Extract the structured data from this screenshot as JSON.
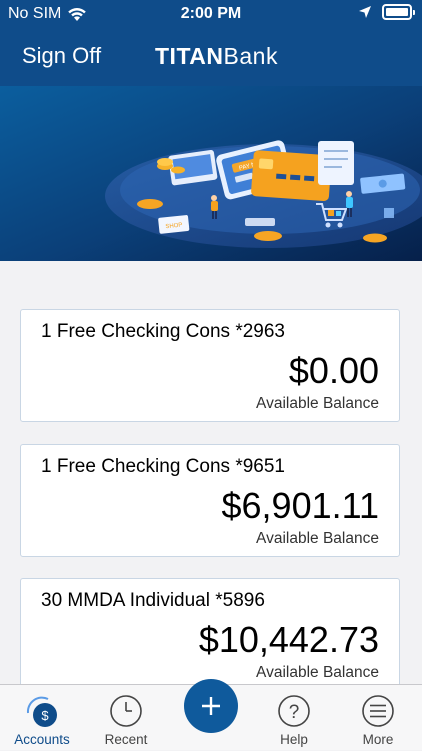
{
  "status_bar": {
    "carrier": "No SIM",
    "time": "2:00 PM"
  },
  "header": {
    "sign_off": "Sign Off",
    "brand_bold": "TITAN",
    "brand_light": "Bank"
  },
  "hero": {
    "badge_text": "PAY NOW",
    "tag_text": "SHOP"
  },
  "accounts": [
    {
      "name": "1 Free Checking Cons *2963",
      "balance": "$0.00",
      "label": "Available Balance"
    },
    {
      "name": "1 Free Checking Cons *9651",
      "balance": "$6,901.11",
      "label": "Available Balance"
    },
    {
      "name": "30 MMDA Individual *5896",
      "balance": "$10,442.73",
      "label": "Available Balance"
    }
  ],
  "tabbar": {
    "accounts": "Accounts",
    "recent": "Recent",
    "help": "Help",
    "more": "More",
    "help_glyph": "?",
    "accounts_glyph": "$",
    "active": "Accounts"
  },
  "colors": {
    "brand": "#0f4c8a",
    "accent": "#0f5a9c",
    "background": "#f2f2f4"
  }
}
